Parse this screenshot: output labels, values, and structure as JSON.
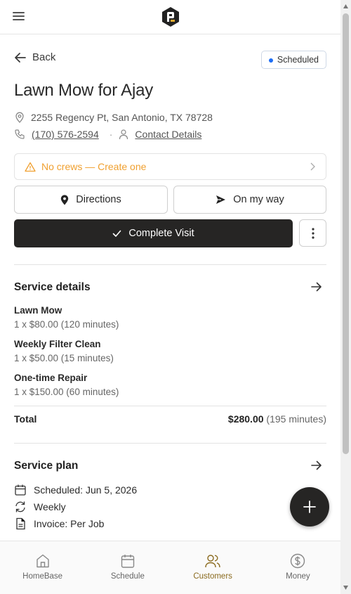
{
  "header": {
    "menu_icon": "hamburger-icon",
    "logo_icon": "app-logo"
  },
  "job": {
    "back_label": "Back",
    "status": "Scheduled",
    "title": "Lawn Mow for Ajay",
    "address": "2255 Regency Pt, San Antonio, TX 78728",
    "phone": "(170) 576-2594",
    "contact_details_label": "Contact Details",
    "crew_warning": "No crews — Create one"
  },
  "actions": {
    "directions_label": "Directions",
    "on_my_way_label": "On my way",
    "complete_label": "Complete Visit"
  },
  "service_details": {
    "title": "Service details",
    "items": [
      {
        "name": "Lawn Mow",
        "detail": "1 x $80.00 (120 minutes)"
      },
      {
        "name": "Weekly Filter Clean",
        "detail": "1 x $50.00 (15 minutes)"
      },
      {
        "name": "One-time Repair",
        "detail": "1 x $150.00 (60 minutes)"
      }
    ],
    "total_label": "Total",
    "total_amount": "$280.00",
    "total_minutes": "(195 minutes)"
  },
  "service_plan": {
    "title": "Service plan",
    "scheduled": "Scheduled: Jun 5, 2026",
    "frequency": "Weekly",
    "invoice": "Invoice: Per Job"
  },
  "bottom_nav": {
    "items": [
      {
        "label": "HomeBase",
        "icon": "home-icon"
      },
      {
        "label": "Schedule",
        "icon": "calendar-icon"
      },
      {
        "label": "Customers",
        "icon": "users-icon"
      },
      {
        "label": "Money",
        "icon": "dollar-icon"
      }
    ],
    "active": "Customers"
  },
  "colors": {
    "accent": "#8a6a1e",
    "warning": "#f0a030",
    "status_dot": "#1e6ef5",
    "dark_button": "#262524"
  }
}
